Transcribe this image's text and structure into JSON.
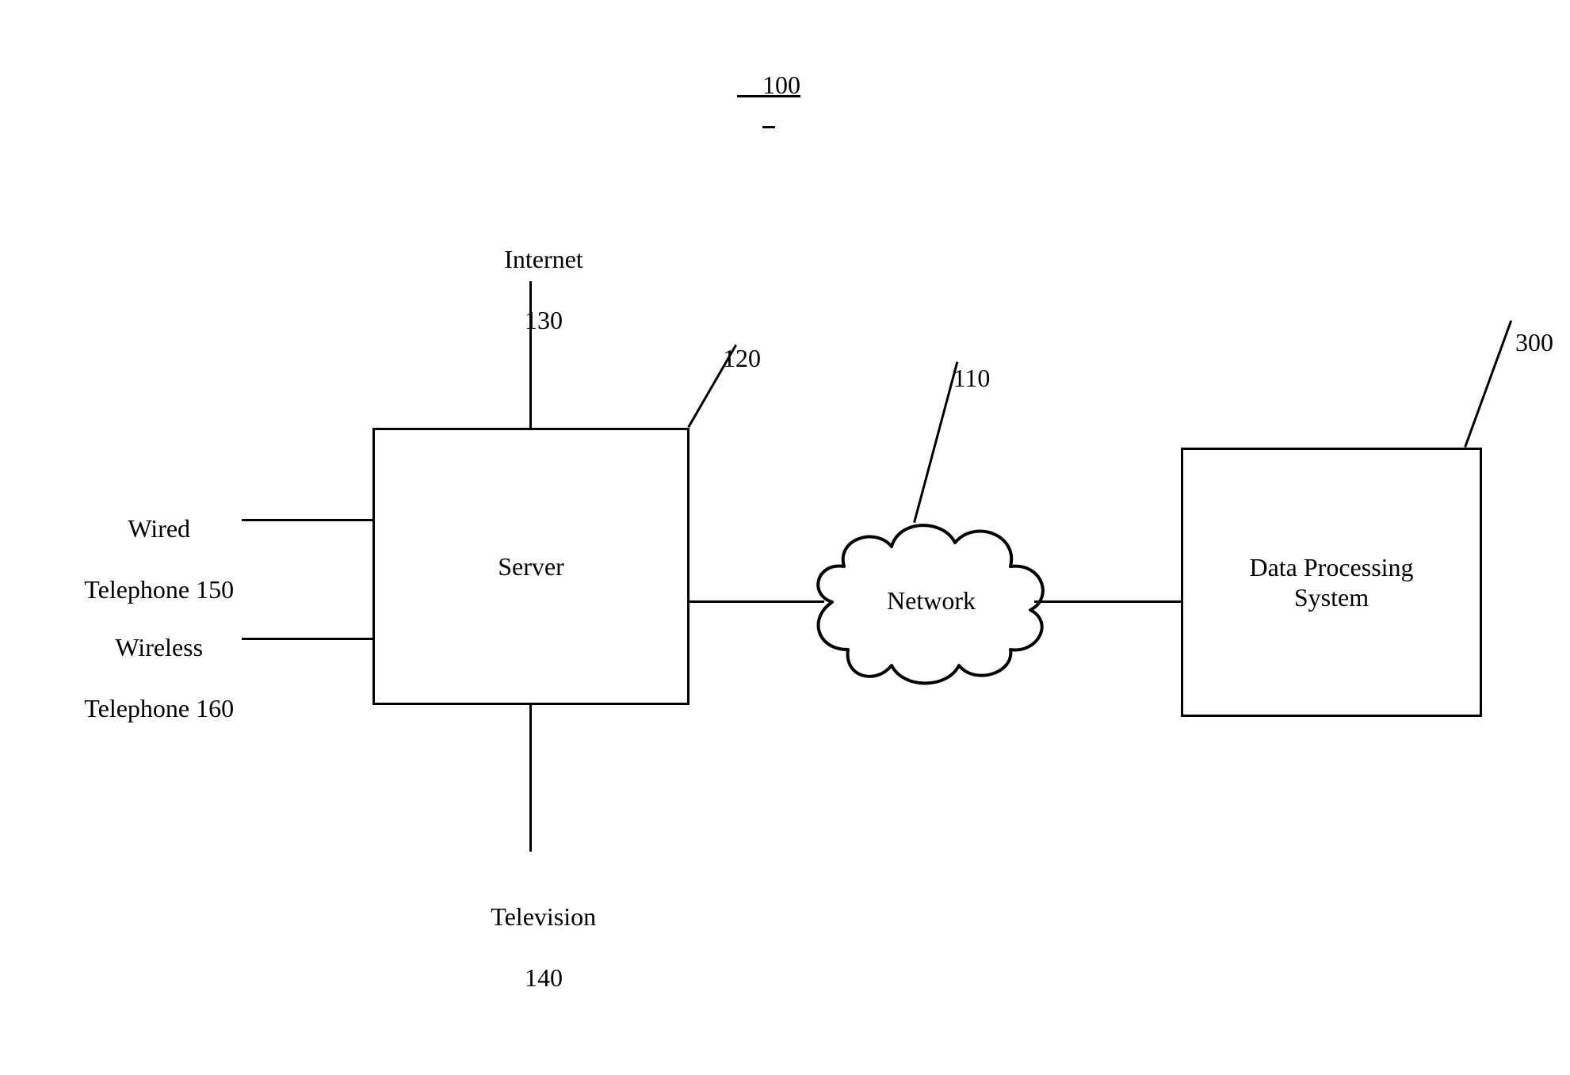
{
  "figure_ref": "100",
  "nodes": {
    "internet": {
      "label": "Internet",
      "ref": "130"
    },
    "television": {
      "label": "Television",
      "ref": "140"
    },
    "wired_tel": {
      "label": "Wired",
      "label2": "Telephone 150"
    },
    "wireless_tel": {
      "label": "Wireless",
      "label2": "Telephone 160"
    },
    "server": {
      "label": "Server",
      "ref": "120"
    },
    "network": {
      "label": "Network",
      "ref": "110"
    },
    "dps": {
      "label": "Data Processing",
      "label2": "System",
      "ref": "300"
    }
  }
}
